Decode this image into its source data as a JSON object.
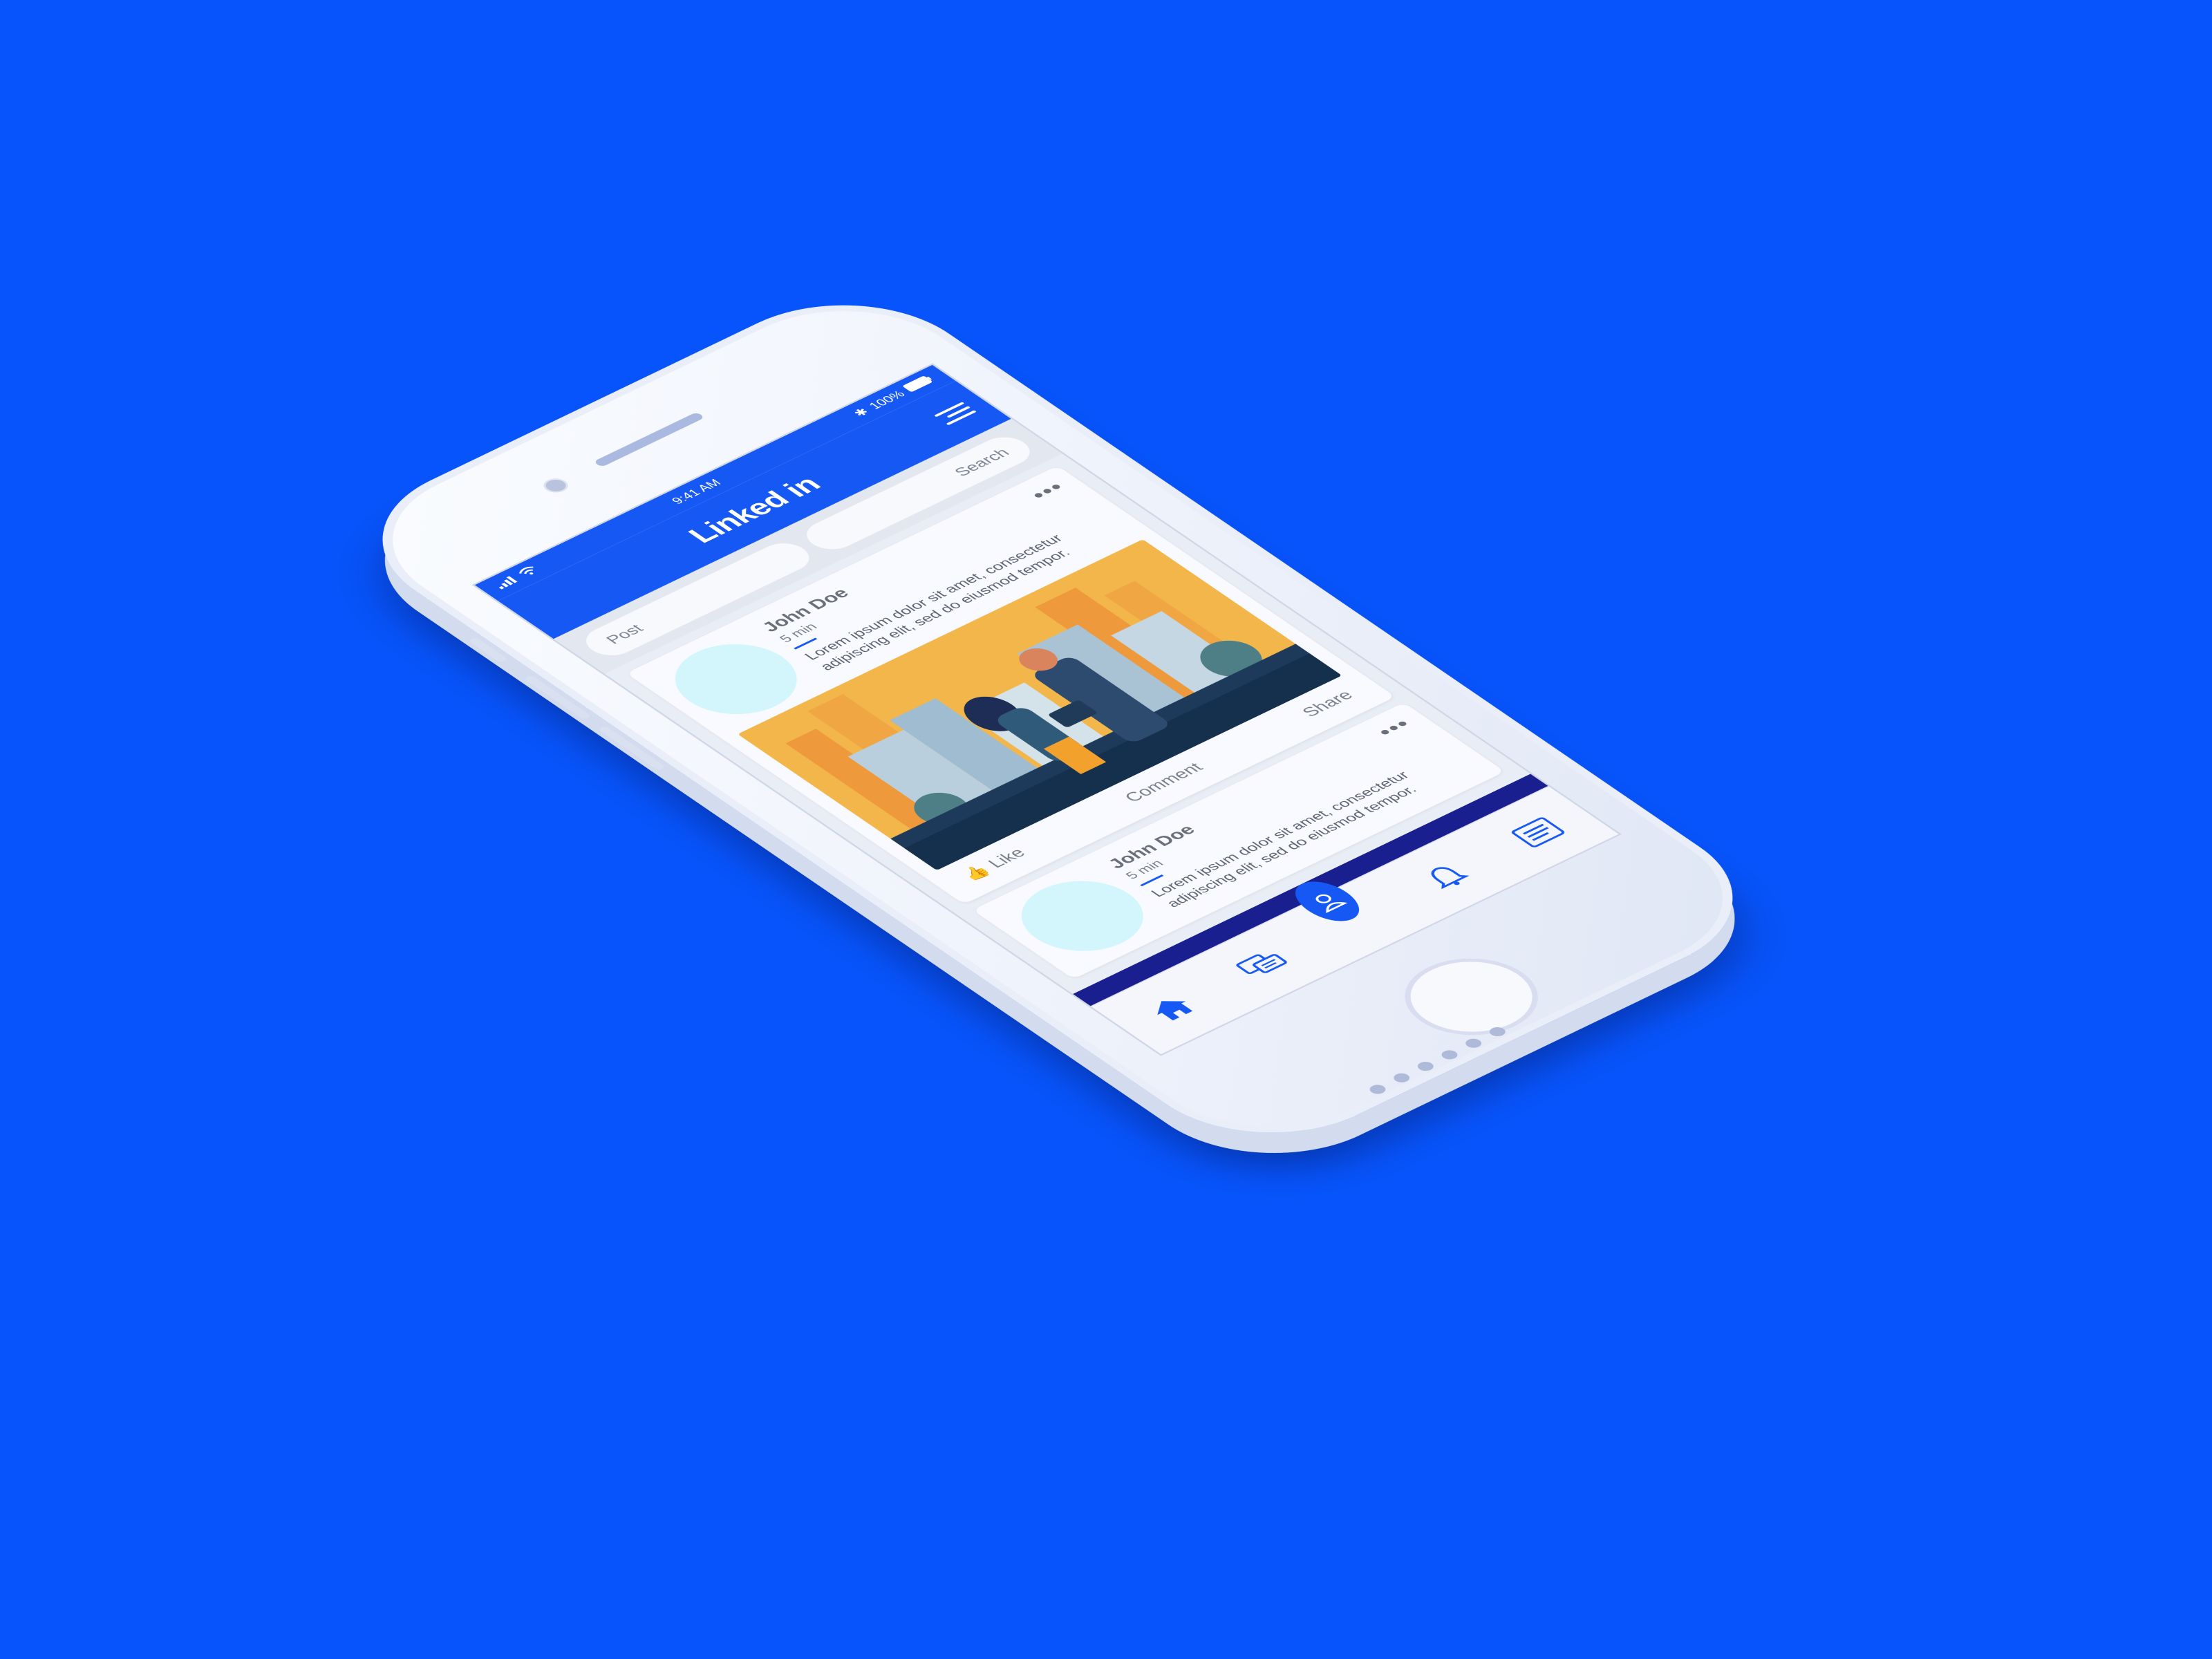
{
  "status": {
    "time": "9:41 AM",
    "battery": "100%"
  },
  "app": {
    "logo": "Linked in"
  },
  "toolbar": {
    "post_placeholder": "Post",
    "search_placeholder": "Search"
  },
  "posts": [
    {
      "author": "John Doe",
      "time": "5 min",
      "text": "Lorem ipsum dolor sit amet, consectetur adipiscing elit, sed do eiusmod tempor.",
      "actions": {
        "like": "Like",
        "comment": "Comment",
        "share": "Share"
      }
    },
    {
      "author": "John Doe",
      "time": "5 min",
      "text": "Lorem ipsum dolor sit amet, consectetur adipiscing elit, sed do eiusmod tempor."
    }
  ],
  "tabs": [
    "home-icon",
    "messages-icon",
    "profile-icon",
    "bell-icon",
    "news-icon"
  ],
  "colors": {
    "background": "#0754fd",
    "brand": "#1558f3",
    "tab_band": "#1a1f8f",
    "avatar": "#d2f6fb"
  }
}
